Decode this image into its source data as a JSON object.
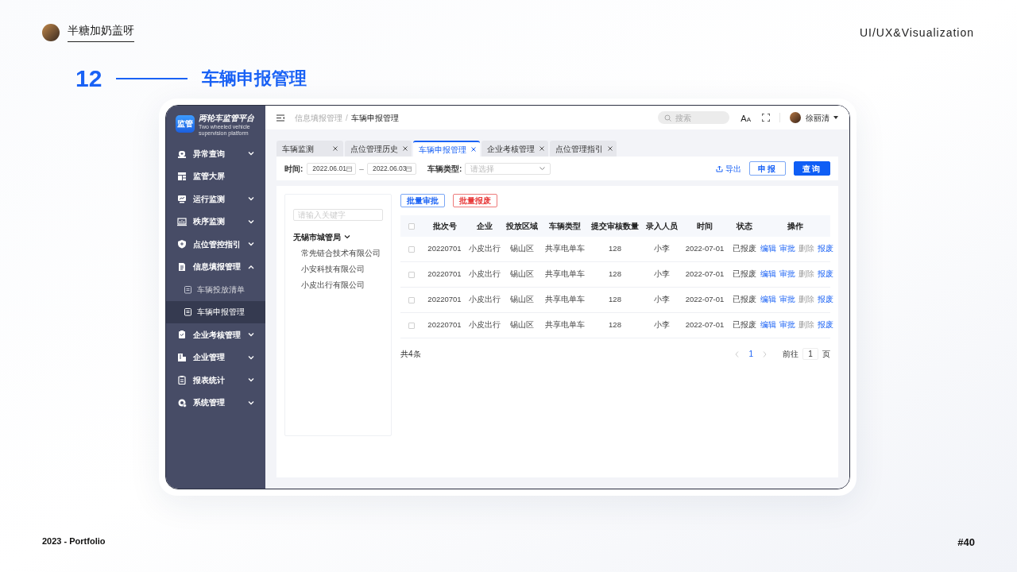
{
  "header": {
    "author": "半糖加奶盖呀",
    "tagline": "UI/UX&Visualization"
  },
  "section": {
    "number": "12",
    "title": "车辆申报管理"
  },
  "app": {
    "logo": {
      "badge": "监管",
      "title": "两轮车监管平台",
      "subtitle": "Two wheeled vehicle supervision platform"
    },
    "sidebar": {
      "items": [
        {
          "label": "异常查询",
          "kind": "group",
          "expanded": false
        },
        {
          "label": "监管大屏",
          "kind": "link"
        },
        {
          "label": "运行监测",
          "kind": "group",
          "expanded": false
        },
        {
          "label": "秩序监测",
          "kind": "group",
          "expanded": false
        },
        {
          "label": "点位管控指引",
          "kind": "group",
          "expanded": false
        },
        {
          "label": "信息填报管理",
          "kind": "group",
          "expanded": true,
          "children": [
            {
              "label": "车辆投放清单",
              "selected": false
            },
            {
              "label": "车辆申报管理",
              "selected": true
            }
          ]
        },
        {
          "label": "企业考核管理",
          "kind": "group",
          "expanded": false
        },
        {
          "label": "企业管理",
          "kind": "group",
          "expanded": false
        },
        {
          "label": "报表统计",
          "kind": "group",
          "expanded": false
        },
        {
          "label": "系统管理",
          "kind": "group",
          "expanded": false
        }
      ]
    },
    "topbar": {
      "breadcrumb": [
        "信息填报管理",
        "车辆申报管理"
      ],
      "separator": "/",
      "search": {
        "placeholder": "搜索"
      },
      "font_size": "AA",
      "user": "徐丽清"
    },
    "tabs": [
      {
        "label": "车辆监测",
        "selected": false
      },
      {
        "label": "点位管理历史",
        "selected": false
      },
      {
        "label": "车辆申报管理",
        "selected": true
      },
      {
        "label": "企业考核管理",
        "selected": false
      },
      {
        "label": "点位管理指引",
        "selected": false
      }
    ],
    "filters": {
      "time_label": "时间:",
      "start": "2022.06.01",
      "range_separator": "–",
      "end": "2022.06.03",
      "type_label": "车辆类型:",
      "type_placeholder": "请选择",
      "export": "导出",
      "buttons": [
        {
          "label": "申报",
          "kind": "outline"
        },
        {
          "label": "查询",
          "kind": "solid"
        }
      ]
    },
    "tree": {
      "search": {
        "placeholder": "请输入关键字"
      },
      "root": {
        "label": "无锡市城管局",
        "expanded": true,
        "children": [
          {
            "label": "常先链合技术有限公司"
          },
          {
            "label": "小安科技有限公司"
          },
          {
            "label": "小皮出行有限公司"
          }
        ]
      }
    },
    "batch_buttons": [
      {
        "label": "批量审批",
        "kind": "primary"
      },
      {
        "label": "批量报废",
        "kind": "danger"
      }
    ],
    "table": {
      "header_checked": false,
      "columns": [
        "批次号",
        "企业",
        "投放区域",
        "车辆类型",
        "提交审核数量",
        "录入人员",
        "时间",
        "状态",
        "操作"
      ],
      "rows": [
        {
          "checked": false,
          "cells": [
            "20220701",
            "小皮出行",
            "锡山区",
            "共享电单车",
            "128",
            "小李",
            "2022-07-01",
            "已报废"
          ],
          "actions": [
            {
              "label": "编辑",
              "disabled": false
            },
            {
              "label": "审批",
              "disabled": false
            },
            {
              "label": "删除",
              "disabled": true
            },
            {
              "label": "报废",
              "disabled": false
            }
          ]
        },
        {
          "checked": false,
          "cells": [
            "20220701",
            "小皮出行",
            "锡山区",
            "共享电单车",
            "128",
            "小李",
            "2022-07-01",
            "已报废"
          ],
          "actions": [
            {
              "label": "编辑",
              "disabled": false
            },
            {
              "label": "审批",
              "disabled": false
            },
            {
              "label": "删除",
              "disabled": true
            },
            {
              "label": "报废",
              "disabled": false
            }
          ]
        },
        {
          "checked": false,
          "cells": [
            "20220701",
            "小皮出行",
            "锡山区",
            "共享电单车",
            "128",
            "小李",
            "2022-07-01",
            "已报废"
          ],
          "actions": [
            {
              "label": "编辑",
              "disabled": false
            },
            {
              "label": "审批",
              "disabled": false
            },
            {
              "label": "删除",
              "disabled": true
            },
            {
              "label": "报废",
              "disabled": false
            }
          ]
        },
        {
          "checked": false,
          "cells": [
            "20220701",
            "小皮出行",
            "锡山区",
            "共享电单车",
            "128",
            "小李",
            "2022-07-01",
            "已报废"
          ],
          "actions": [
            {
              "label": "编辑",
              "disabled": false
            },
            {
              "label": "审批",
              "disabled": false
            },
            {
              "label": "删除",
              "disabled": true
            },
            {
              "label": "报废",
              "disabled": false
            }
          ]
        }
      ]
    },
    "pagination": {
      "total": "共4条",
      "pages": [
        {
          "label": "1",
          "selected": true
        }
      ],
      "goto": "前往",
      "page_input": "1",
      "suffix": "页"
    }
  },
  "footer": {
    "left": "2023 - Portfolio",
    "right": "#40"
  }
}
